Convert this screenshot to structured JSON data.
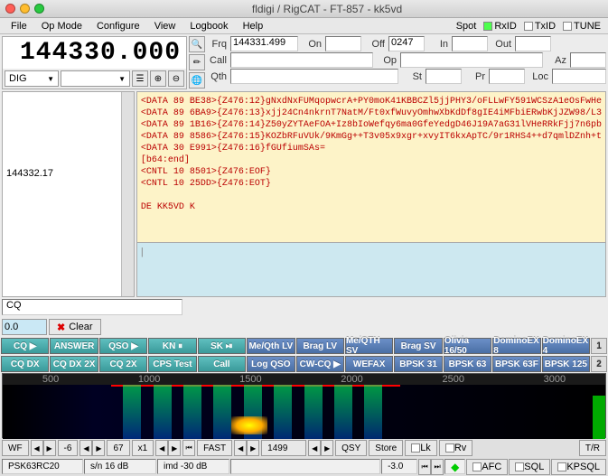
{
  "title": "fldigi / RigCAT - FT-857 - kk5vd",
  "menu": [
    "File",
    "Op Mode",
    "Configure",
    "View",
    "Logbook",
    "Help"
  ],
  "top_right": {
    "spot": "Spot",
    "rxid": "RxID",
    "txid": "TxID",
    "tune": "TUNE"
  },
  "freq_display": "144330.000",
  "mode_combo": "DIG",
  "fields": {
    "frq_lbl": "Frq",
    "frq_val": "144331.499",
    "on_lbl": "On",
    "off_lbl": "Off",
    "off_val": "0247",
    "in_lbl": "In",
    "out_lbl": "Out",
    "call_lbl": "Call",
    "op_lbl": "Op",
    "az_lbl": "Az",
    "qth_lbl": "Qth",
    "st_lbl": "St",
    "pr_lbl": "Pr",
    "loc_lbl": "Loc"
  },
  "left_freq": "144332.17",
  "rx_lines": [
    "<DATA 89 BE38>{Z476:12}gNxdNxFUMqopwcrA+PY0moK41KBBCZl5jjPHY3/oFLLwFY591WCSzA1eOsFwHe",
    "<DATA 89 6BA9>{Z476:13}xjj24Cn4nkrnT7NatM/Ft0xfWuvyOmhwXbKdDf8gIE4iMFbiERwbKjJZW98/L3",
    "<DATA 89 1B16>{Z476:14}Z50yZYTAeFOA+Iz8bIoWefqy6ma0GfeYedgD46J19A7aG31lVHeRRkFjj7n6pb",
    "<DATA 89 8586>{Z476:15}KOZbRFuVUk/9KmGg++T3v05x9xgr+xvyIT6kxApTC/9r1RHS4++d7qmlDZnh+t",
    "<DATA 30 E991>{Z476:16}fGUfiumSAs=",
    "[b64:end]",
    "<CNTL 10 8501>{Z476:EOF}",
    "<CNTL 10 25DD>{Z476:EOT}",
    "",
    "DE KK5VD K"
  ],
  "cq_label": "CQ",
  "spinner_val": "0.0",
  "clear_label": "Clear",
  "macros": {
    "row1": [
      "CQ ▶",
      "ANSWER",
      "QSO ▶",
      "KN ⏸",
      "SK ⏯",
      "Me/Qth LV",
      "Brag LV",
      "Me/QTH SV",
      "Brag SV",
      "Olivia 16/50",
      "DominoEX 8",
      "DominoEX 4"
    ],
    "row2": [
      "CQ DX",
      "CQ DX 2X",
      "CQ 2X",
      "CPS Test",
      "Call",
      "Log QSO",
      "CW-CQ ▶",
      "WEFAX",
      "BPSK 31",
      "BPSK 63",
      "BPSK 63F",
      "BPSK 125"
    ],
    "n1": "1",
    "n2": "2"
  },
  "wf_ticks": [
    "500",
    "1000",
    "1500",
    "2000",
    "2500",
    "3000"
  ],
  "bottom": {
    "wf": "WF",
    "v1": "-6",
    "v2": "67",
    "x1": "x1",
    "fast": "FAST",
    "freq": "1499",
    "qsy": "QSY",
    "store": "Store",
    "lk": "Lk",
    "rv": "Rv",
    "tr": "T/R"
  },
  "status": {
    "mode": "PSK63RC20",
    "sn_lbl": "s/n 16 dB",
    "imd_lbl": "imd -30 dB",
    "val": "-3.0",
    "afc": "AFC",
    "sql": "SQL",
    "kpsql": "KPSQL"
  }
}
